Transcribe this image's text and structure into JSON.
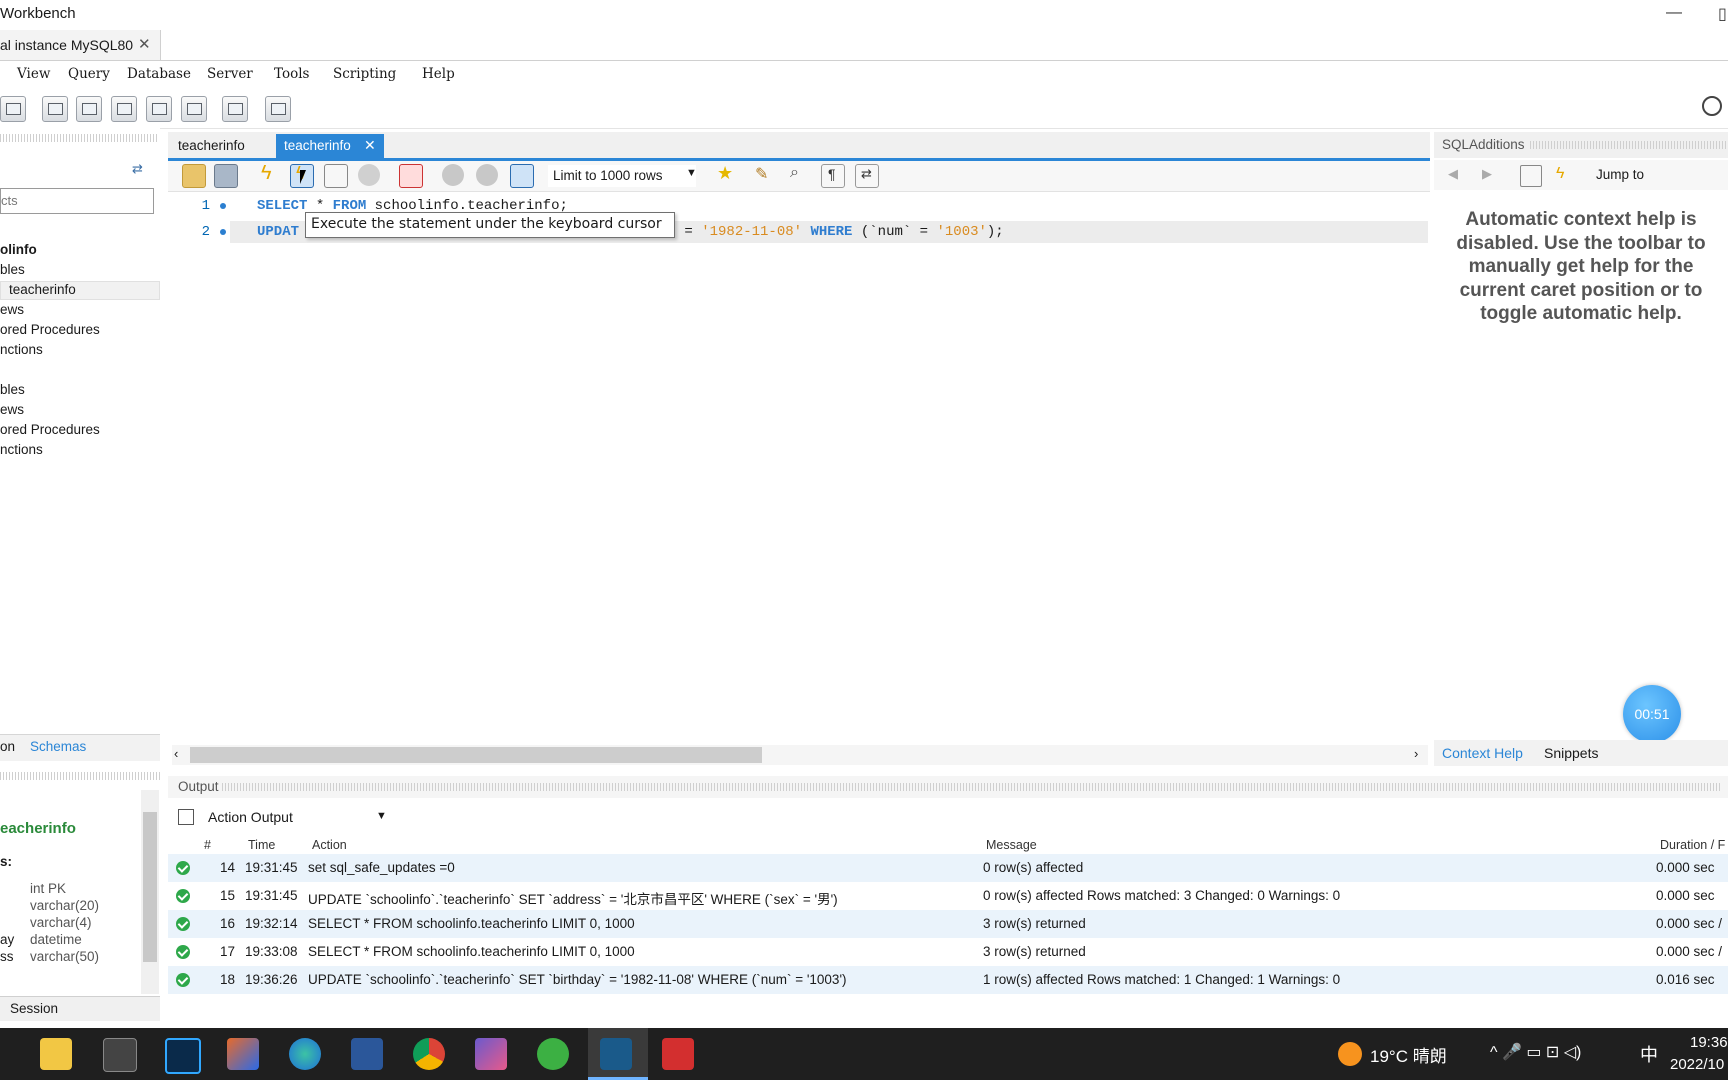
{
  "window": {
    "title": "Workbench"
  },
  "connection_tab": {
    "label": "al instance MySQL80",
    "close": "✕"
  },
  "menu": [
    "View",
    "Query",
    "Database",
    "Server",
    "Tools",
    "Scripting",
    "Help"
  ],
  "navigator": {
    "search_placeholder": "cts",
    "tree": [
      "olinfo",
      "bles",
      "teacherinfo",
      "ews",
      "ored Procedures",
      "nctions",
      "bles",
      "ews",
      "ored Procedures",
      "nctions"
    ],
    "tabs": [
      "on",
      "Schemas"
    ],
    "info_title": "eacherinfo",
    "info_section": "s:",
    "columns": [
      {
        "name": "",
        "type": "int PK"
      },
      {
        "name": "",
        "type": "varchar(20)"
      },
      {
        "name": "",
        "type": "varchar(4)"
      },
      {
        "name": "ay",
        "type": "datetime"
      },
      {
        "name": "ss",
        "type": "varchar(50)"
      }
    ],
    "session_tab": "Session"
  },
  "query_tabs": [
    {
      "label": "teacherinfo"
    },
    {
      "label": "teacherinfo",
      "active": true,
      "close": "✕"
    }
  ],
  "editor_toolbar": {
    "limit_label": "Limit to 1000 rows"
  },
  "editor": {
    "line1": {
      "num": "1",
      "kw1": "SELECT",
      "mid": " * ",
      "kw2": "FROM",
      "rest": " schoolinfo.teacherinfo;"
    },
    "line2": {
      "num": "2",
      "kw1": "UPDAT",
      "eq": " = ",
      "str1": "'1982-11-08'",
      "kw2": " WHERE ",
      "p1": "(`num` = ",
      "str2": "'1003'",
      "p2": ");"
    }
  },
  "tooltip": "Execute the statement under the keyboard cursor",
  "sql_additions": {
    "title": "SQLAdditions",
    "jump_to": "Jump to",
    "context_help": "Automatic context help is disabled. Use the toolbar to manually get help for the current caret position or to toggle automatic help.",
    "tabs": [
      "Context Help",
      "Snippets"
    ]
  },
  "timer": "00:51",
  "output": {
    "title": "Output",
    "selector": "Action Output",
    "headers": {
      "num": "#",
      "time": "Time",
      "action": "Action",
      "message": "Message",
      "duration": "Duration / F"
    },
    "rows": [
      {
        "num": "14",
        "time": "19:31:45",
        "action": "set sql_safe_updates =0",
        "message": "0 row(s) affected",
        "duration": "0.000 sec"
      },
      {
        "num": "15",
        "time": "19:31:45",
        "action": "UPDATE `schoolinfo`.`teacherinfo` SET `address` = '北京市昌平区' WHERE (`sex` = '男')",
        "message": "0 row(s) affected Rows matched: 3  Changed: 0  Warnings: 0",
        "duration": "0.000 sec"
      },
      {
        "num": "16",
        "time": "19:32:14",
        "action": "SELECT * FROM schoolinfo.teacherinfo LIMIT 0, 1000",
        "message": "3 row(s) returned",
        "duration": "0.000 sec /"
      },
      {
        "num": "17",
        "time": "19:33:08",
        "action": "SELECT * FROM schoolinfo.teacherinfo LIMIT 0, 1000",
        "message": "3 row(s) returned",
        "duration": "0.000 sec /"
      },
      {
        "num": "18",
        "time": "19:36:26",
        "action": "UPDATE `schoolinfo`.`teacherinfo` SET `birthday` = '1982-11-08' WHERE (`num` = '1003')",
        "message": "1 row(s) affected Rows matched: 1  Changed: 1  Warnings: 0",
        "duration": "0.016 sec"
      }
    ]
  },
  "taskbar": {
    "weather": "19°C 晴朗",
    "ime": "中",
    "time": "19:36",
    "date": "2022/10"
  }
}
